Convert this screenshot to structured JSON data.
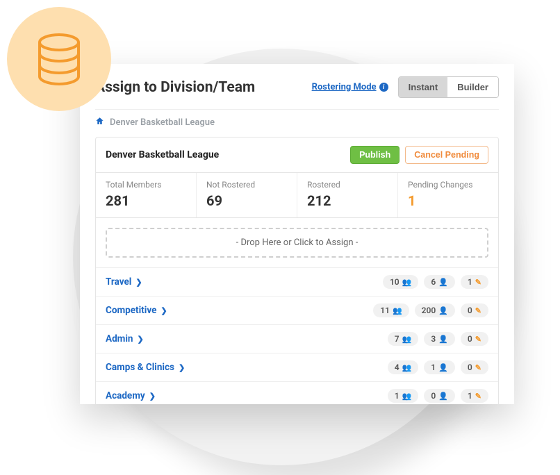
{
  "header": {
    "title": "Assign to Division/Team",
    "mode_label": "Rostering Mode",
    "toggle": {
      "instant": "Instant",
      "builder": "Builder"
    }
  },
  "breadcrumb": {
    "org": "Denver Basketball League"
  },
  "panel": {
    "league_name": "Denver Basketball League",
    "publish_label": "Publish",
    "cancel_label": "Cancel Pending"
  },
  "stats": {
    "total_label": "Total Members",
    "total_value": "281",
    "notrostered_label": "Not Rostered",
    "notrostered_value": "69",
    "rostered_label": "Rostered",
    "rostered_value": "212",
    "pending_label": "Pending Changes",
    "pending_value": "1"
  },
  "dropzone": {
    "text": "- Drop Here or Click to Assign -"
  },
  "rows": [
    {
      "name": "Travel",
      "groups": "10",
      "people": "6",
      "pending": "1"
    },
    {
      "name": "Competitive",
      "groups": "11",
      "people": "200",
      "pending": "0"
    },
    {
      "name": "Admin",
      "groups": "7",
      "people": "3",
      "pending": "0"
    },
    {
      "name": "Camps & Clinics",
      "groups": "4",
      "people": "1",
      "pending": "0"
    },
    {
      "name": "Academy",
      "groups": "1",
      "people": "0",
      "pending": "1"
    }
  ]
}
